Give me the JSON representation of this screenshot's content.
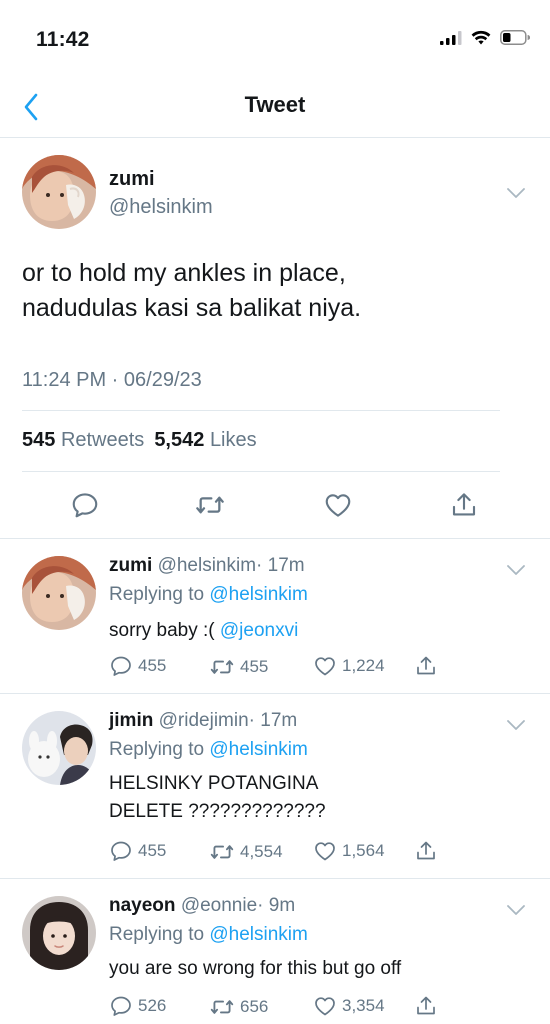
{
  "status_bar": {
    "time": "11:42"
  },
  "nav": {
    "title": "Tweet"
  },
  "main_tweet": {
    "name": "zumi",
    "handle": "@helsinkim",
    "text_line1": "or to hold my ankles in place,",
    "text_line2": "nadudulas kasi sa balikat niya.",
    "timestamp": "11:24 PM · 06/29/23",
    "retweets_count": "545",
    "retweets_label": "Retweets",
    "likes_count": "5,542",
    "likes_label": "Likes"
  },
  "replies": [
    {
      "name": "zumi",
      "handle": "@helsinkim",
      "time": "· 17m",
      "replying_prefix": "Replying to",
      "replying_to": "@helsinkim",
      "text": "sorry baby :(",
      "mention": "@jeonxvi",
      "comments": "455",
      "retweets": "455",
      "likes": "1,224"
    },
    {
      "name": "jimin",
      "handle": "@ridejimin",
      "time": "· 17m",
      "replying_prefix": "Replying to",
      "replying_to": "@helsinkim",
      "text_line1": "HELSINKY POTANGINA",
      "text_line2": "DELETE ?????????????",
      "comments": "455",
      "retweets": "4,554",
      "likes": "1,564"
    },
    {
      "name": "nayeon",
      "handle": "@eonnie",
      "time": "· 9m",
      "replying_prefix": "Replying to",
      "replying_to": "@helsinkim",
      "text": "you are so wrong for this but go off",
      "comments": "526",
      "retweets": "656",
      "likes": "3,354"
    }
  ],
  "icons": {
    "status": [
      "signal-icon",
      "wifi-icon",
      "battery-icon"
    ],
    "nav": [
      "back-chevron-icon"
    ],
    "actions": [
      "reply-icon",
      "retweet-icon",
      "like-icon",
      "share-icon"
    ],
    "menu": "chevron-down-icon"
  },
  "colors": {
    "accent": "#1da1f2",
    "secondary_text": "#657786",
    "divider": "#e1e8ed"
  }
}
